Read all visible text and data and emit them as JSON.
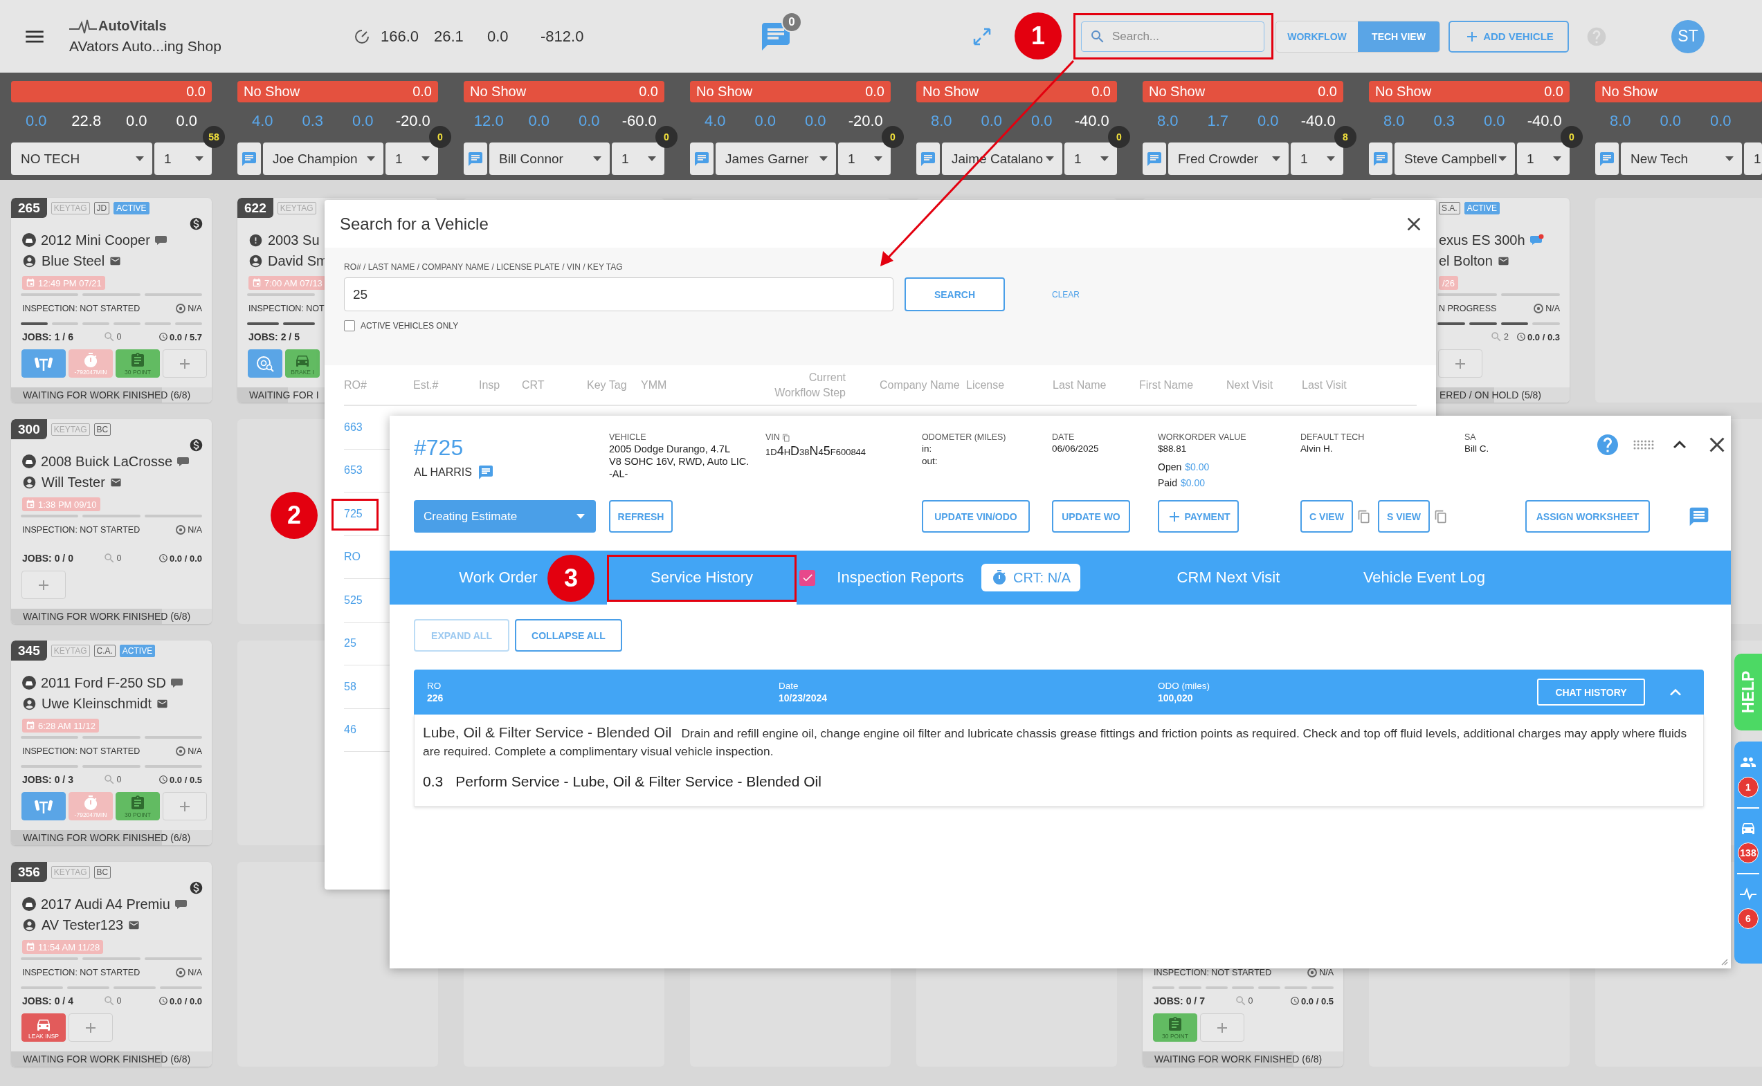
{
  "header": {
    "brand": "AutoVitals",
    "shop_name": "AVators Auto...ing Shop",
    "metrics": [
      "166.0",
      "26.1",
      "0.0",
      "-812.0"
    ],
    "message_count": "0",
    "search": {
      "placeholder": "Search..."
    },
    "views": [
      {
        "label": "WORKFLOW",
        "selected": false
      },
      {
        "label": "TECH VIEW",
        "selected": true
      }
    ],
    "add_vehicle": "ADD VEHICLE",
    "user_initials": "ST"
  },
  "techs": [
    {
      "total": "0.0",
      "readings": [
        {
          "value": "0.0",
          "color": "#5aa8ec"
        },
        {
          "value": "22.8",
          "color": "#ffffff"
        },
        {
          "value": "0.0",
          "color": "#ffffff"
        },
        {
          "value": "0.0",
          "color": "#ffffff"
        }
      ],
      "chat": false,
      "name": "NO TECH",
      "shift": "1",
      "badge": "58"
    },
    {
      "status": "No Show",
      "total": "0.0",
      "readings": [
        {
          "value": "4.0",
          "color": "#5aa8ec"
        },
        {
          "value": "0.3",
          "color": "#5aa8ec"
        },
        {
          "value": "0.0",
          "color": "#5aa8ec"
        },
        {
          "value": "-20.0",
          "color": "#ffffff"
        }
      ],
      "chat": true,
      "name": "Joe Champion",
      "shift": "1",
      "badge": "0"
    },
    {
      "status": "No Show",
      "total": "0.0",
      "readings": [
        {
          "value": "12.0",
          "color": "#5aa8ec"
        },
        {
          "value": "0.0",
          "color": "#5aa8ec"
        },
        {
          "value": "0.0",
          "color": "#5aa8ec"
        },
        {
          "value": "-60.0",
          "color": "#ffffff"
        }
      ],
      "chat": true,
      "name": "Bill Connor",
      "shift": "1",
      "badge": "0"
    },
    {
      "status": "No Show",
      "total": "0.0",
      "readings": [
        {
          "value": "4.0",
          "color": "#5aa8ec"
        },
        {
          "value": "0.0",
          "color": "#5aa8ec"
        },
        {
          "value": "0.0",
          "color": "#5aa8ec"
        },
        {
          "value": "-20.0",
          "color": "#ffffff"
        }
      ],
      "chat": true,
      "name": "James Garner",
      "shift": "1",
      "badge": "0"
    },
    {
      "status": "No Show",
      "total": "0.0",
      "readings": [
        {
          "value": "8.0",
          "color": "#5aa8ec"
        },
        {
          "value": "0.0",
          "color": "#5aa8ec"
        },
        {
          "value": "0.0",
          "color": "#5aa8ec"
        },
        {
          "value": "-40.0",
          "color": "#ffffff"
        }
      ],
      "chat": true,
      "name": "Jaime Catalano",
      "shift": "1",
      "badge": "0"
    },
    {
      "status": "No Show",
      "total": "0.0",
      "readings": [
        {
          "value": "8.0",
          "color": "#5aa8ec"
        },
        {
          "value": "1.7",
          "color": "#5aa8ec"
        },
        {
          "value": "0.0",
          "color": "#5aa8ec"
        },
        {
          "value": "-40.0",
          "color": "#ffffff"
        }
      ],
      "chat": true,
      "name": "Fred Crowder",
      "shift": "1",
      "badge": "8"
    },
    {
      "status": "No Show",
      "total": "0.0",
      "readings": [
        {
          "value": "8.0",
          "color": "#5aa8ec"
        },
        {
          "value": "0.3",
          "color": "#5aa8ec"
        },
        {
          "value": "0.0",
          "color": "#5aa8ec"
        },
        {
          "value": "-40.0",
          "color": "#ffffff"
        }
      ],
      "chat": true,
      "name": "Steve Campbell",
      "shift": "1",
      "badge": "0"
    },
    {
      "status": "No Show",
      "readings": [
        {
          "value": "8.0",
          "color": "#5aa8ec"
        },
        {
          "value": "0.0",
          "color": "#5aa8ec"
        },
        {
          "value": "0.0",
          "color": "#5aa8ec"
        }
      ],
      "chat": true,
      "name": "New Tech",
      "shift": "1"
    }
  ],
  "board": [
    {
      "slots": [
        {
          "kind": "vehicle",
          "ro": "265",
          "tags": [
            {
              "label": "KEYTAG",
              "kind": "keytag"
            },
            {
              "label": "JD",
              "kind": "initials"
            },
            {
              "label": "ACTIVE",
              "kind": "active"
            }
          ],
          "dollar": true,
          "vehicle_alert": false,
          "vehicle": "2012 Mini Cooper",
          "chat_unread": false,
          "customer": "Blue Steel",
          "has_email": true,
          "appointment": "12:49 PM 07/21",
          "inspection_steps": [
            {
              "done": false
            },
            {
              "done": false
            },
            {
              "done": false
            }
          ],
          "inspection": "INSPECTION: NOT STARTED",
          "inspection_value": "N/A",
          "job_steps": [
            {
              "done": true
            },
            {
              "done": false
            },
            {
              "done": false
            },
            {
              "done": false
            },
            {
              "done": false
            },
            {
              "done": false
            }
          ],
          "jobs": "JOBS: 1 / 6",
          "comments": "0",
          "hours": "0.0 / 5.7",
          "tiles": [
            {
              "kind": "lift"
            },
            {
              "kind": "timer",
              "label": "-792047MIN"
            },
            {
              "kind": "checklist",
              "label": "30 POINT"
            },
            {
              "kind": "add"
            }
          ],
          "status": "WAITING FOR WORK FINISHED (6/8)",
          "level": 0.75
        },
        {
          "kind": "vehicle",
          "ro": "300",
          "tags": [
            {
              "label": "KEYTAG",
              "kind": "keytag"
            },
            {
              "label": "BC",
              "kind": "initials"
            }
          ],
          "dollar": true,
          "vehicle_alert": false,
          "vehicle": "2008 Buick LaCrosse",
          "chat_unread": false,
          "customer": "Will Tester",
          "has_email": true,
          "appointment": "1:38 PM 09/10",
          "inspection_steps": [
            {
              "done": false
            },
            {
              "done": false
            },
            {
              "done": false
            }
          ],
          "inspection": "INSPECTION: NOT STARTED",
          "inspection_value": "N/A",
          "jobs": "JOBS: 0 / 0",
          "comments": "0",
          "hours": "0.0 / 0.0",
          "tiles": [
            {
              "kind": "add"
            }
          ],
          "status": "WAITING FOR WORK FINISHED (6/8)",
          "level": 0.75
        },
        {
          "kind": "vehicle",
          "ro": "345",
          "tags": [
            {
              "label": "KEYTAG",
              "kind": "keytag"
            },
            {
              "label": "C.A.",
              "kind": "initials"
            },
            {
              "label": "ACTIVE",
              "kind": "active"
            }
          ],
          "dollar": false,
          "vehicle_alert": false,
          "vehicle": "2011 Ford F-250 SD",
          "chat_unread": false,
          "customer": "Uwe Kleinschmidt",
          "has_email": true,
          "appointment": "6:28 AM 11/12",
          "inspection_steps": [
            {
              "done": false
            },
            {
              "done": false
            },
            {
              "done": false
            }
          ],
          "inspection": "INSPECTION: NOT STARTED",
          "inspection_value": "N/A",
          "job_steps": [
            {
              "done": false
            },
            {
              "done": false
            },
            {
              "done": false
            }
          ],
          "jobs": "JOBS: 0 / 3",
          "comments": "0",
          "hours": "0.0 / 0.5",
          "tiles": [
            {
              "kind": "lift"
            },
            {
              "kind": "timer",
              "label": "-792047MIN"
            },
            {
              "kind": "checklist",
              "label": "30 POINT"
            },
            {
              "kind": "add"
            }
          ],
          "status": "WAITING FOR WORK FINISHED (6/8)",
          "level": 0.75
        },
        {
          "kind": "vehicle",
          "ro": "356",
          "tags": [
            {
              "label": "KEYTAG",
              "kind": "keytag"
            },
            {
              "label": "BC",
              "kind": "initials"
            }
          ],
          "dollar": true,
          "vehicle_alert": false,
          "vehicle": "2017 Audi A4 Premiu",
          "chat_unread": false,
          "customer": "AV Tester123",
          "has_email": true,
          "appointment": "11:54 AM 11/28",
          "inspection_steps": [
            {
              "done": false
            },
            {
              "done": false
            },
            {
              "done": false
            }
          ],
          "inspection": "INSPECTION: NOT STARTED",
          "inspection_value": "N/A",
          "job_steps": [
            {
              "done": false
            },
            {
              "done": false
            },
            {
              "done": false
            },
            {
              "done": false
            }
          ],
          "jobs": "JOBS: 0 / 4",
          "comments": "0",
          "hours": "0.0 / 0.0",
          "tiles": [
            {
              "kind": "leak",
              "label": "LEAK INSP"
            },
            {
              "kind": "add"
            }
          ],
          "status": "WAITING FOR WORK FINISHED (6/8)",
          "level": 0.75
        }
      ]
    },
    {
      "slots": [
        {
          "kind": "vehicle",
          "ro": "622",
          "tags": [
            {
              "label": "KEYTAG",
              "kind": "keytag"
            }
          ],
          "vehicle_alert": true,
          "vehicle": "2003 Su",
          "customer": "David Sm",
          "appointment": "7:00 AM 07/13",
          "inspection_steps": [
            {
              "done": false
            }
          ],
          "inspection": "INSPECTION: NOT",
          "job_steps": [
            {
              "done": true
            },
            {
              "done": true
            }
          ],
          "jobs": "JOBS: 2 / 5",
          "tiles": [
            {
              "kind": "brake"
            },
            {
              "kind": "car_lift",
              "label": "BRAKE I"
            }
          ],
          "status": "WAITING FOR I",
          "level": 0.25
        },
        {
          "kind": "empty"
        },
        {
          "kind": "empty"
        },
        {
          "kind": "empty"
        }
      ]
    },
    {
      "slots": [
        {
          "kind": "empty"
        },
        {
          "kind": "empty"
        },
        {
          "kind": "empty"
        },
        {
          "kind": "empty"
        }
      ]
    },
    {
      "slots": [
        {
          "kind": "empty"
        },
        {
          "kind": "empty"
        },
        {
          "kind": "empty"
        },
        {
          "kind": "empty"
        }
      ]
    },
    {
      "slots": [
        {
          "kind": "empty"
        },
        {
          "kind": "empty"
        },
        {
          "kind": "empty"
        },
        {
          "kind": "empty"
        }
      ]
    },
    {
      "slots": [
        {
          "kind": "empty"
        },
        {
          "kind": "empty"
        },
        {
          "kind": "empty"
        },
        {
          "kind": "vehicle",
          "inspection": "INSPECTION: NOT STARTED",
          "inspection_value": "N/A",
          "job_steps": [
            {
              "done": false
            },
            {
              "done": false
            },
            {
              "done": false
            },
            {
              "done": false
            },
            {
              "done": false
            },
            {
              "done": false
            },
            {
              "done": false
            }
          ],
          "jobs": "JOBS: 0 / 7",
          "comments": "0",
          "hours": "0.0 / 0.5",
          "tiles": [
            {
              "kind": "checklist",
              "label": "30 POINT"
            },
            {
              "kind": "add"
            }
          ],
          "status": "WAITING FOR WORK FINISHED (6/8)",
          "level": 0.75
        }
      ]
    },
    {
      "slots": [
        {
          "kind": "vehicle",
          "tags": [
            {
              "label": "S.A.",
              "kind": "initials"
            },
            {
              "label": "ACTIVE",
              "kind": "active"
            }
          ],
          "vehicle": "exus ES 300h",
          "chat_unread": true,
          "customer": "el Bolton",
          "has_email": true,
          "appointment": "/26",
          "inspection_steps": [
            {
              "done": false
            },
            {
              "done": false
            }
          ],
          "inspection": "N PROGRESS",
          "inspection_value": "N/A",
          "job_steps": [
            {
              "done": true
            },
            {
              "done": true
            },
            {
              "done": true
            },
            {
              "done": false
            }
          ],
          "comments": "2",
          "hours": "0.0 / 0.3",
          "tiles": [
            {
              "kind": "add"
            }
          ],
          "status": "ERED / ON HOLD (5/8)",
          "level": 0.625
        },
        {
          "kind": "empty"
        },
        {
          "kind": "empty"
        },
        {
          "kind": "empty"
        }
      ]
    },
    {
      "slots": [
        {
          "kind": "empty"
        },
        {
          "kind": "empty"
        },
        {
          "kind": "empty"
        },
        {
          "kind": "empty"
        }
      ]
    }
  ],
  "search_dialog": {
    "title": "Search for a Vehicle",
    "field_label": "RO# / LAST NAME / COMPANY NAME / LICENSE PLATE / VIN / KEY TAG",
    "query": "25",
    "search_button": "SEARCH",
    "clear_link": "CLEAR",
    "active_only": {
      "label": "ACTIVE VEHICLES ONLY",
      "checked": false
    },
    "columns": [
      "RO#",
      "Est.#",
      "Insp",
      "CRT",
      "Key Tag",
      "YMM",
      "Current Workflow Step",
      "Company Name",
      "License",
      "Last Name",
      "First Name",
      "Next Visit",
      "Last Visit"
    ],
    "rows": [
      {
        "ro": "663"
      },
      {
        "ro": "653"
      },
      {
        "ro": "725"
      },
      {
        "ro": "RO"
      },
      {
        "ro": "525"
      },
      {
        "ro": "25"
      },
      {
        "ro": "58"
      },
      {
        "ro": "46"
      }
    ]
  },
  "work_order": {
    "number": "#725",
    "customer": "AL HARRIS",
    "vehicle": {
      "label": "VEHICLE",
      "value": "2005 Dodge Durango, 4.7L\nV8 SOHC 16V, RWD, Auto LIC.\n-AL-"
    },
    "vin": {
      "label": "VIN",
      "value": "1D**4**H**D**38**N**4**5**F600844"
    },
    "odometer": {
      "label": "ODOMETER (MILES)",
      "in": "in:",
      "out": "out:"
    },
    "date": {
      "label": "DATE",
      "value": "06/06/2025"
    },
    "value": {
      "label": "WORKORDER VALUE",
      "total": "$88.81",
      "open_label": "Open",
      "open": "$0.00",
      "paid_label": "Paid",
      "paid": "$0.00"
    },
    "default_tech": {
      "label": "DEFAULT TECH",
      "value": "Alvin H."
    },
    "sa": {
      "label": "SA",
      "value": "Bill C."
    },
    "status": "Creating Estimate",
    "actions": {
      "refresh": "REFRESH",
      "update_vin": "UPDATE VIN/ODO",
      "update_wo": "UPDATE WO",
      "payment": "PAYMENT",
      "c_view": "C VIEW",
      "s_view": "S VIEW",
      "assign": "ASSIGN WORKSHEET"
    },
    "tabs": [
      {
        "label": "Work Order",
        "selected": false
      },
      {
        "label": "Service History",
        "selected": true
      },
      {
        "label": "Inspection Reports",
        "selected": false,
        "checked": true,
        "timer": "CRT: N/A"
      },
      {
        "label": "CRM Next Visit",
        "selected": false
      },
      {
        "label": "Vehicle Event Log",
        "selected": false
      }
    ],
    "history": {
      "expand_all": {
        "label": "EXPAND ALL",
        "disabled": true
      },
      "collapse_all": {
        "label": "COLLAPSE ALL",
        "disabled": false
      },
      "entries": [
        {
          "ro_label": "RO",
          "ro": "226",
          "date_label": "Date",
          "date": "10/23/2024",
          "odo_label": "ODO (miles)",
          "odo": "100,020",
          "chat_button": "CHAT HISTORY",
          "expanded": true,
          "service": "Lube, Oil & Filter Service - Blended Oil",
          "description": "Drain and refill engine oil, change engine oil filter and lubricate chassis grease fittings and friction points as required. Check and top off fluid levels, additional charges may apply where fluids are required. Complete a complimentary visual vehicle inspection.",
          "lines": [
            {
              "hours": "0.3",
              "text": "Perform Service - Lube, Oil & Filter Service - Blended Oil"
            }
          ]
        }
      ]
    }
  },
  "help_tab": "HELP",
  "side_panel": [
    {
      "kind": "team",
      "badge": "1"
    },
    {
      "kind": "vehicles",
      "badge": "138"
    },
    {
      "kind": "activity",
      "badge": "6"
    }
  ],
  "callouts": [
    "1",
    "2",
    "3"
  ]
}
